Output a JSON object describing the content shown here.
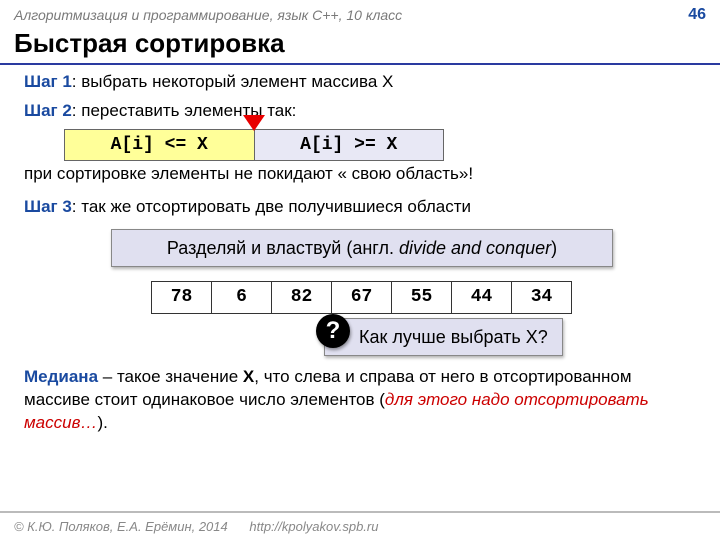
{
  "header": {
    "course": "Алгоритмизация и программирование, язык C++, 10 класс",
    "page": "46"
  },
  "title": "Быстрая сортировка",
  "step1": {
    "label": "Шаг 1",
    "text": ": выбрать некоторый элемент массива X"
  },
  "step2": {
    "label": "Шаг 2",
    "text": ": переставить элементы так:"
  },
  "partition": {
    "left": "A[i] <= X",
    "right": "A[i] >= X"
  },
  "after_partition": "при сортировке элементы не покидают « свою область»!",
  "step3": {
    "label": "Шаг 3",
    "text": ": так же отсортировать две получившиеся области"
  },
  "motto": {
    "ru": "Разделяй и властвуй (англ. ",
    "en": "divide and conquer",
    "close": ")"
  },
  "array": [
    "78",
    "6",
    "82",
    "67",
    "55",
    "44",
    "34"
  ],
  "question": {
    "mark": "?",
    "text": "Как лучше выбрать X?"
  },
  "median": {
    "label": "Медиана",
    "body1": " – такое значение ",
    "xbold": "X",
    "body2": ", что слева и справа от него в отсортированном массиве стоит одинаковое число элементов (",
    "italic": "для этого надо отсортировать массив…",
    "body3": ")."
  },
  "footer": {
    "copyright": "© К.Ю. Поляков, Е.А. Ерёмин, 2014",
    "url": "http://kpolyakov.spb.ru"
  }
}
